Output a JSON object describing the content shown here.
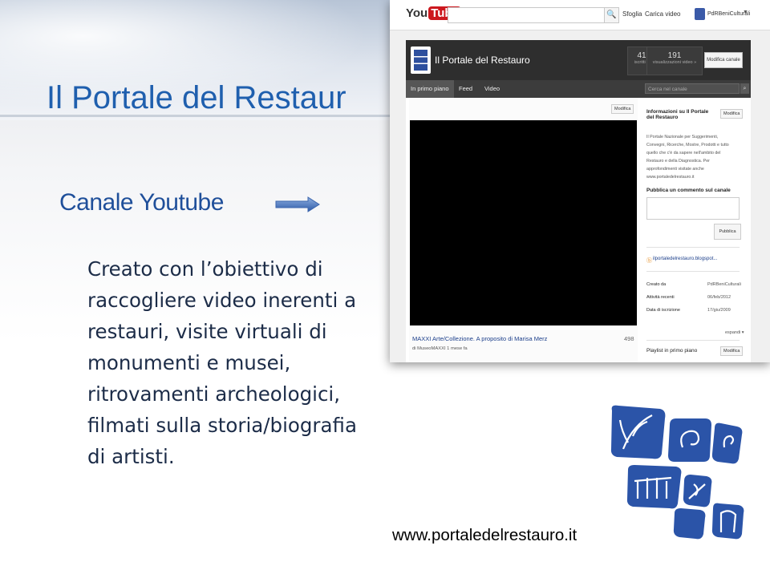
{
  "slide": {
    "title": "Il Portale del Restaur",
    "subtitle": "Canale Youtube",
    "body_lines": [
      "Creato con l’obiettivo di",
      "raccogliere video inerenti a",
      "restauri, visite virtuali di",
      "monumenti e musei,",
      "ritrovamenti archeologici,",
      "filmati sulla storia/biografia",
      "di artisti."
    ],
    "website": "www.portaledelrestauro.it",
    "accent_color": "#1f5fae"
  },
  "youtube": {
    "logo_you": "You",
    "logo_tube": "Tube",
    "search_button": "🔍",
    "links": [
      "Sfoglia",
      "Carica video"
    ],
    "user": "PdRBeniCulturali",
    "channel_name": "Il Portale del Restauro",
    "stats": [
      {
        "value": "41",
        "label": "iscritti »"
      },
      {
        "value": "191",
        "label": "visualizzazioni video »"
      }
    ],
    "edit_channel": "Modifica canale",
    "tabs": [
      "In primo piano",
      "Feed",
      "Video"
    ],
    "channel_search_placeholder": "Cerca nel canale",
    "edit_small": "Modifica",
    "video": {
      "title": "MAXXI Arte/Collezione. A proposito di Marisa Merz",
      "views": "498",
      "author": "di MuseoMAXXI 1 mese fa"
    },
    "sidebar": {
      "info_title": "Informazioni su Il Portale del Restauro",
      "info_text": "Il Portale Nazionale per Suggerimenti, Convegni, Ricerche, Mostre, Prodotti e tutto quello che c'è da sapere nell'ambito del Restauro e della Diagnostica. Per approfondimenti visitate anche www.portaledelrestauro.it",
      "comment_title": "Pubblica un commento sul canale",
      "publish": "Pubblica",
      "blog": "ilportaledelrestauro.blogspot...",
      "meta": [
        {
          "label": "Creato da",
          "value": "PdRBeniCulturali"
        },
        {
          "label": "Attività recenti",
          "value": "06/feb/2012"
        },
        {
          "label": "Data di iscrizione",
          "value": "17/giu/2009"
        }
      ],
      "expand": "espandi ▾",
      "playlist": "Playlist in primo piano"
    }
  }
}
